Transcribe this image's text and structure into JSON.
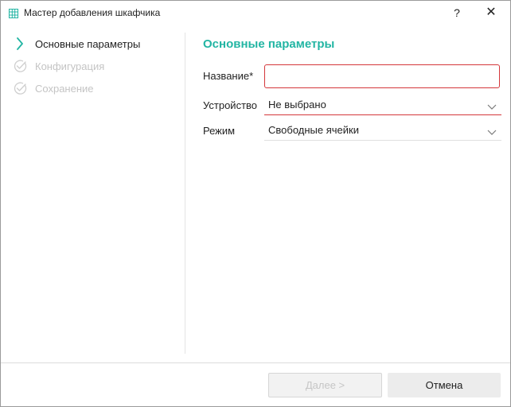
{
  "window": {
    "title": "Мастер добавления шкафчика",
    "help_label": "?",
    "close_label": "✕",
    "icons": {
      "app": "table-grid-icon",
      "help": "question-icon",
      "close": "close-icon"
    }
  },
  "steps": [
    {
      "label": "Основные параметры",
      "state": "active",
      "icon": "chevron-right-icon"
    },
    {
      "label": "Конфигурация",
      "state": "inactive",
      "icon": "check-circle-icon"
    },
    {
      "label": "Сохранение",
      "state": "inactive",
      "icon": "check-circle-icon"
    }
  ],
  "form": {
    "section_title": "Основные параметры",
    "name": {
      "label": "Название*",
      "value": "",
      "placeholder": ""
    },
    "device": {
      "label": "Устройство",
      "value": "Не выбрано"
    },
    "mode": {
      "label": "Режим",
      "value": "Свободные ячейки"
    }
  },
  "footer": {
    "next_label": "Далее >",
    "cancel_label": "Отмена"
  },
  "colors": {
    "accent": "#22b5a3",
    "error": "#d4373b",
    "inactive_text": "#c4c4c4"
  }
}
